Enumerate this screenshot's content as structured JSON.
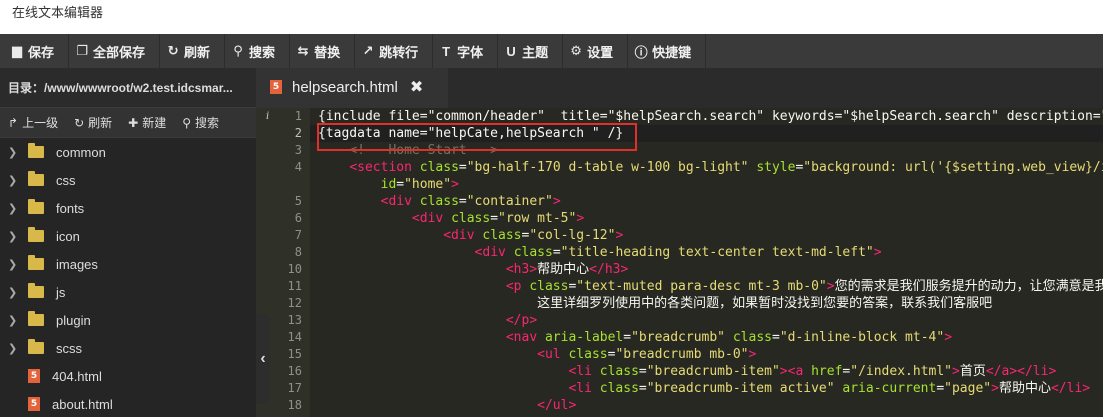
{
  "window": {
    "title": "在线文本编辑器"
  },
  "toolbar": {
    "buttons": [
      {
        "label": "保存",
        "icon": "save-icon",
        "glyph": "▆"
      },
      {
        "label": "全部保存",
        "icon": "save-all-icon",
        "glyph": "❐"
      },
      {
        "label": "刷新",
        "icon": "refresh-icon",
        "glyph": "↻"
      },
      {
        "label": "搜索",
        "icon": "search-icon",
        "glyph": "⚲"
      },
      {
        "label": "替换",
        "icon": "replace-icon",
        "glyph": "⇆"
      },
      {
        "label": "跳转行",
        "icon": "goto-line-icon",
        "glyph": "↗"
      },
      {
        "label": "字体",
        "icon": "font-icon",
        "glyph": "T"
      },
      {
        "label": "主题",
        "icon": "theme-icon",
        "glyph": "U"
      },
      {
        "label": "设置",
        "icon": "gear-icon",
        "glyph": "⚙"
      },
      {
        "label": "快捷键",
        "icon": "info-icon",
        "glyph": "ⓘ"
      }
    ]
  },
  "sidebar": {
    "dir_label": "目录：/www/wwwroot/w2.test.idcsmar...",
    "actions": [
      {
        "label": "上一级",
        "icon": "arrow-up-icon",
        "glyph": "↱"
      },
      {
        "label": "刷新",
        "icon": "refresh-icon",
        "glyph": "↻"
      },
      {
        "label": "新建",
        "icon": "plus-icon",
        "glyph": "✚"
      },
      {
        "label": "搜索",
        "icon": "search-icon",
        "glyph": "⚲"
      }
    ],
    "items": [
      {
        "name": "common",
        "type": "folder"
      },
      {
        "name": "css",
        "type": "folder"
      },
      {
        "name": "fonts",
        "type": "folder"
      },
      {
        "name": "icon",
        "type": "folder"
      },
      {
        "name": "images",
        "type": "folder"
      },
      {
        "name": "js",
        "type": "folder"
      },
      {
        "name": "plugin",
        "type": "folder"
      },
      {
        "name": "scss",
        "type": "folder"
      },
      {
        "name": "404.html",
        "type": "html"
      },
      {
        "name": "about.html",
        "type": "html"
      }
    ],
    "collapse_glyph": "‹"
  },
  "tab": {
    "filename": "helpsearch.html",
    "close_glyph": "✖",
    "file_badge": "5"
  },
  "editor": {
    "info_marker_line": 1,
    "active_line": 2,
    "lines": [
      {
        "n": "1",
        "parts": [
          [
            "t",
            "{include file=\"common/header\"  title=\"$helpSearch.search\" keywords=\"$helpSearch.search\" description=\"$helpSearch.search\"}"
          ]
        ]
      },
      {
        "n": "2",
        "parts": [
          [
            "t",
            "{tagdata name=\"helpCate,helpSearch \" /}"
          ]
        ]
      },
      {
        "n": "3",
        "parts": [
          [
            "t",
            "    "
          ],
          [
            "c",
            "<!-- Home Start -->"
          ]
        ]
      },
      {
        "n": "4",
        "parts": [
          [
            "t",
            "    "
          ],
          [
            "g",
            "<section"
          ],
          [
            "t",
            " "
          ],
          [
            "a",
            "class"
          ],
          [
            "t",
            "="
          ],
          [
            "s",
            "\"bg-half-170 d-table w-100 bg-light\""
          ],
          [
            "t",
            " "
          ],
          [
            "a",
            "style"
          ],
          [
            "t",
            "="
          ],
          [
            "s",
            "\"background: url('{$setting.web_view}/images/help.png')\""
          ]
        ]
      },
      {
        "n": "",
        "parts": [
          [
            "t",
            "        "
          ],
          [
            "a",
            "id"
          ],
          [
            "t",
            "="
          ],
          [
            "s",
            "\"home\""
          ],
          [
            "g",
            ">"
          ]
        ]
      },
      {
        "n": "5",
        "parts": [
          [
            "t",
            "        "
          ],
          [
            "g",
            "<div"
          ],
          [
            "t",
            " "
          ],
          [
            "a",
            "class"
          ],
          [
            "t",
            "="
          ],
          [
            "s",
            "\"container\""
          ],
          [
            "g",
            ">"
          ]
        ]
      },
      {
        "n": "6",
        "parts": [
          [
            "t",
            "            "
          ],
          [
            "g",
            "<div"
          ],
          [
            "t",
            " "
          ],
          [
            "a",
            "class"
          ],
          [
            "t",
            "="
          ],
          [
            "s",
            "\"row mt-5\""
          ],
          [
            "g",
            ">"
          ]
        ]
      },
      {
        "n": "7",
        "parts": [
          [
            "t",
            "                "
          ],
          [
            "g",
            "<div"
          ],
          [
            "t",
            " "
          ],
          [
            "a",
            "class"
          ],
          [
            "t",
            "="
          ],
          [
            "s",
            "\"col-lg-12\""
          ],
          [
            "g",
            ">"
          ]
        ]
      },
      {
        "n": "8",
        "parts": [
          [
            "t",
            "                    "
          ],
          [
            "g",
            "<div"
          ],
          [
            "t",
            " "
          ],
          [
            "a",
            "class"
          ],
          [
            "t",
            "="
          ],
          [
            "s",
            "\"title-heading text-center text-md-left\""
          ],
          [
            "g",
            ">"
          ]
        ]
      },
      {
        "n": "10",
        "parts": [
          [
            "t",
            "                        "
          ],
          [
            "g",
            "<h3>"
          ],
          [
            "t",
            "帮助中心"
          ],
          [
            "g",
            "</h3>"
          ]
        ]
      },
      {
        "n": "11",
        "parts": [
          [
            "t",
            "                        "
          ],
          [
            "g",
            "<p"
          ],
          [
            "t",
            " "
          ],
          [
            "a",
            "class"
          ],
          [
            "t",
            "="
          ],
          [
            "s",
            "\"text-muted para-desc mt-3 mb-0\""
          ],
          [
            "g",
            ">"
          ],
          [
            "t",
            "您的需求是我们服务提升的动力，让您满意是我们的追求"
          ]
        ]
      },
      {
        "n": "12",
        "parts": [
          [
            "t",
            "                            这里详细罗列使用中的各类问题，如果暂时没找到您要的答案，联系我们客服吧"
          ]
        ]
      },
      {
        "n": "13",
        "parts": [
          [
            "t",
            "                        "
          ],
          [
            "g",
            "</p>"
          ]
        ]
      },
      {
        "n": "14",
        "parts": [
          [
            "t",
            "                        "
          ],
          [
            "g",
            "<nav"
          ],
          [
            "t",
            " "
          ],
          [
            "a",
            "aria-label"
          ],
          [
            "t",
            "="
          ],
          [
            "s",
            "\"breadcrumb\""
          ],
          [
            "t",
            " "
          ],
          [
            "a",
            "class"
          ],
          [
            "t",
            "="
          ],
          [
            "s",
            "\"d-inline-block mt-4\""
          ],
          [
            "g",
            ">"
          ]
        ]
      },
      {
        "n": "15",
        "parts": [
          [
            "t",
            "                            "
          ],
          [
            "g",
            "<ul"
          ],
          [
            "t",
            " "
          ],
          [
            "a",
            "class"
          ],
          [
            "t",
            "="
          ],
          [
            "s",
            "\"breadcrumb mb-0\""
          ],
          [
            "g",
            ">"
          ]
        ]
      },
      {
        "n": "16",
        "parts": [
          [
            "t",
            "                                "
          ],
          [
            "g",
            "<li"
          ],
          [
            "t",
            " "
          ],
          [
            "a",
            "class"
          ],
          [
            "t",
            "="
          ],
          [
            "s",
            "\"breadcrumb-item\""
          ],
          [
            "g",
            "><a"
          ],
          [
            "t",
            " "
          ],
          [
            "a",
            "href"
          ],
          [
            "t",
            "="
          ],
          [
            "s",
            "\"/index.html\""
          ],
          [
            "g",
            ">"
          ],
          [
            "t",
            "首页"
          ],
          [
            "g",
            "</a></li>"
          ]
        ]
      },
      {
        "n": "17",
        "parts": [
          [
            "t",
            "                                "
          ],
          [
            "g",
            "<li"
          ],
          [
            "t",
            " "
          ],
          [
            "a",
            "class"
          ],
          [
            "t",
            "="
          ],
          [
            "s",
            "\"breadcrumb-item active\""
          ],
          [
            "t",
            " "
          ],
          [
            "a",
            "aria-current"
          ],
          [
            "t",
            "="
          ],
          [
            "s",
            "\"page\""
          ],
          [
            "g",
            ">"
          ],
          [
            "t",
            "帮助中心"
          ],
          [
            "g",
            "</li>"
          ]
        ]
      },
      {
        "n": "18",
        "parts": [
          [
            "t",
            "                            "
          ],
          [
            "g",
            "</ul>"
          ]
        ]
      }
    ]
  },
  "colors": {
    "toolbar_bg": "#3a3a3a",
    "editor_bg": "#272822",
    "highlight_box": "#e0302a",
    "folder": "#d9b84a",
    "html_file": "#e4633c"
  }
}
